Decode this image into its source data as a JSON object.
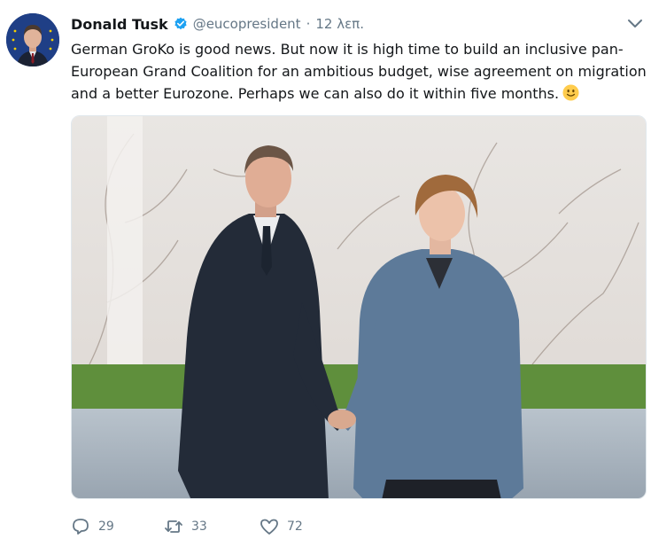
{
  "tweet": {
    "author_name": "Donald Tusk",
    "handle": "@eucopresident",
    "separator": "·",
    "time": "12 λεπ.",
    "text": "German GroKo is good news. But now it is high time to build an inclusive pan-European Grand Coalition for an ambitious budget, wise agreement on migration and a better Eurozone. Perhaps we can also do it within five months.",
    "emoji": "slightly-smiling-face-icon",
    "media": "photo-handshake"
  },
  "actions": {
    "reply_count": "29",
    "retweet_count": "33",
    "like_count": "72"
  },
  "colors": {
    "verified": "#1da1f2",
    "secondary_text": "#657786",
    "primary_text": "#14171a"
  }
}
